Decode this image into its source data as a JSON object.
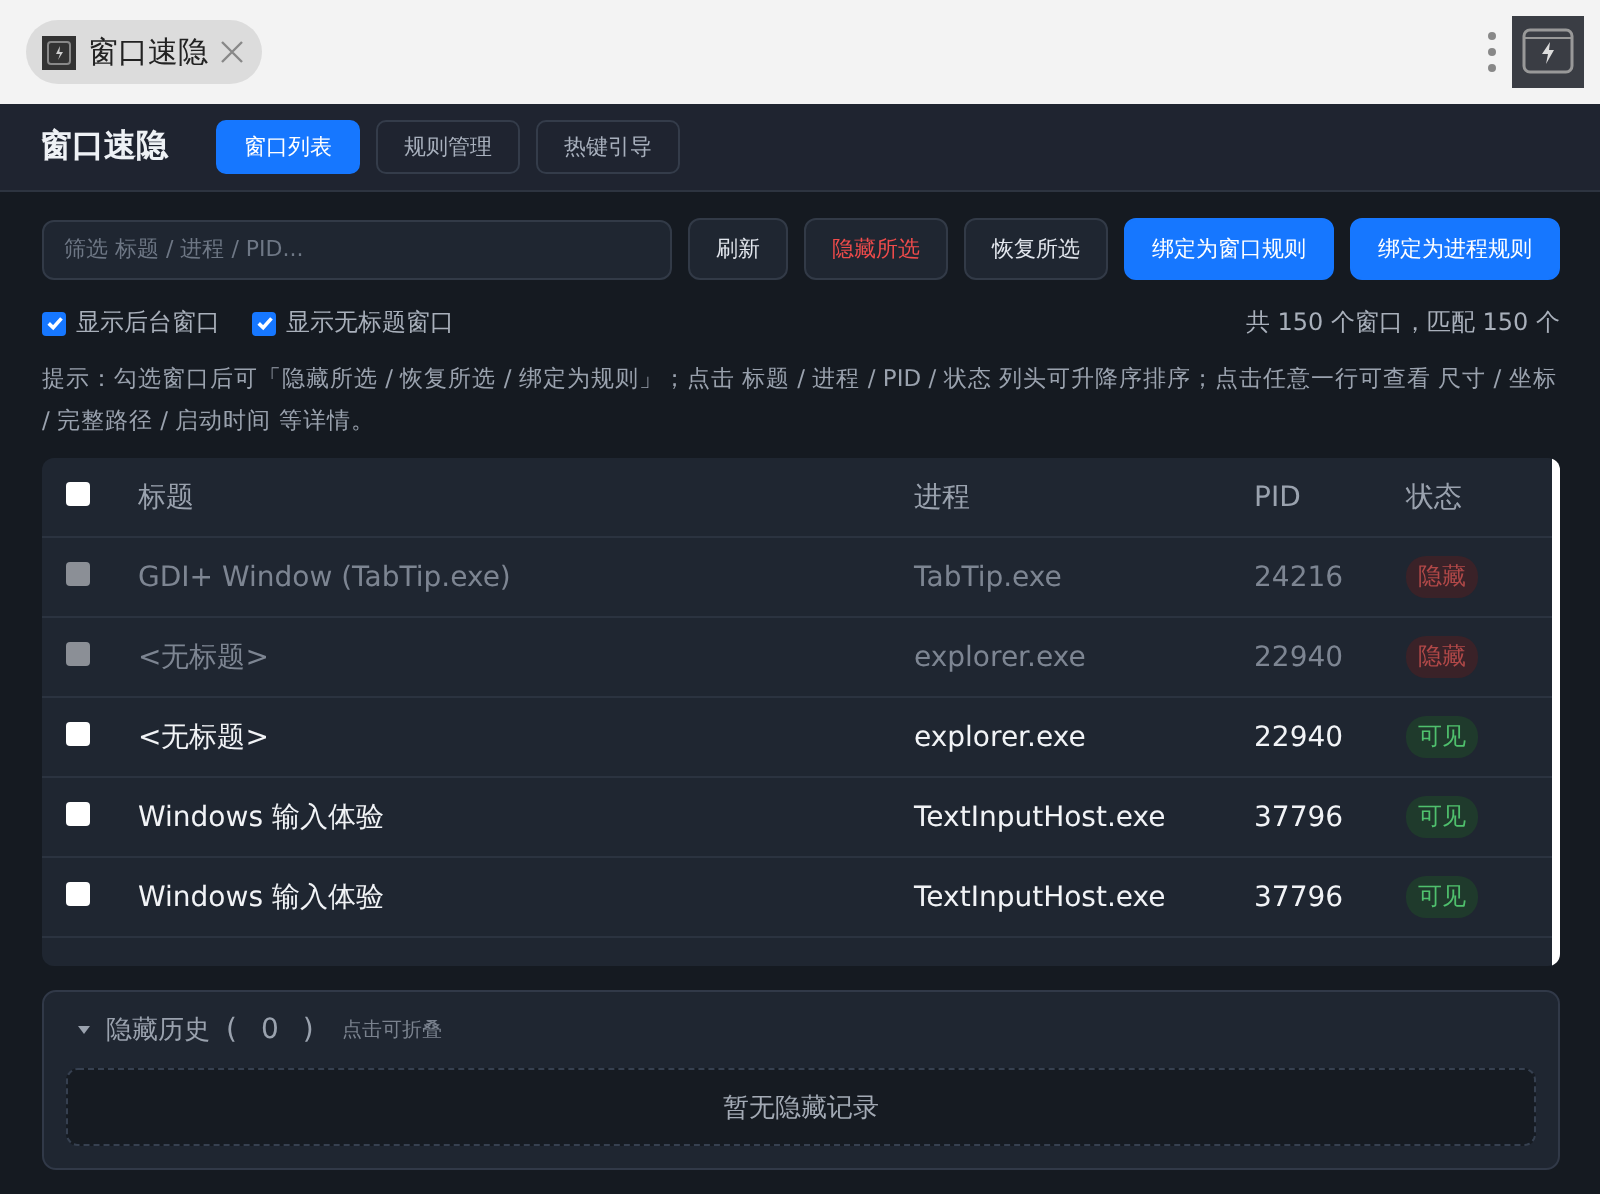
{
  "browser_tab": {
    "title": "窗口速隐"
  },
  "header": {
    "title": "窗口速隐",
    "tabs": [
      {
        "label": "窗口列表",
        "selected": true
      },
      {
        "label": "规则管理",
        "selected": false
      },
      {
        "label": "热键引导",
        "selected": false
      }
    ]
  },
  "toolbar": {
    "search": {
      "placeholder": "筛选 标题 / 进程 / PID..."
    },
    "buttons": [
      {
        "label": "刷新",
        "kind": "default"
      },
      {
        "label": "隐藏所选",
        "kind": "danger"
      },
      {
        "label": "恢复所选",
        "kind": "default"
      },
      {
        "label": "绑定为窗口规则",
        "kind": "primary"
      },
      {
        "label": "绑定为进程规则",
        "kind": "primary"
      }
    ]
  },
  "filters": [
    {
      "label": "显示后台窗口",
      "checked": true
    },
    {
      "label": "显示无标题窗口",
      "checked": true
    }
  ],
  "count": "共 150 个窗口，匹配 150 个",
  "hint": "提示：勾选窗口后可「隐藏所选 / 恢复所选 / 绑定为规则」；点击 标题 / 进程 / PID / 状态 列头可升降序排序；点击任意一行可查看 尺寸 / 坐标 / 完整路径 / 启动时间 等详情。",
  "table": {
    "select_all": {
      "checked": false
    },
    "columns": [
      "标题",
      "进程",
      "PID",
      "状态"
    ],
    "rows": [
      {
        "title": "GDI+ Window (TabTip.exe)",
        "process": "TabTip.exe",
        "pid": "24216",
        "status": "隐藏",
        "hidden": true,
        "checked": false
      },
      {
        "title": "<无标题>",
        "process": "explorer.exe",
        "pid": "22940",
        "status": "隐藏",
        "hidden": true,
        "checked": false
      },
      {
        "title": "<无标题>",
        "process": "explorer.exe",
        "pid": "22940",
        "status": "可见",
        "hidden": false,
        "checked": false
      },
      {
        "title": "Windows 输入体验",
        "process": "TextInputHost.exe",
        "pid": "37796",
        "status": "可见",
        "hidden": false,
        "checked": false
      },
      {
        "title": "Windows 输入体验",
        "process": "TextInputHost.exe",
        "pid": "37796",
        "status": "可见",
        "hidden": false,
        "checked": false
      }
    ]
  },
  "history": {
    "expanded": true,
    "title": "隐藏历史",
    "open": "(",
    "count": "0",
    "close": ")",
    "hint": "点击可折叠",
    "empty": "暂无隐藏记录"
  }
}
